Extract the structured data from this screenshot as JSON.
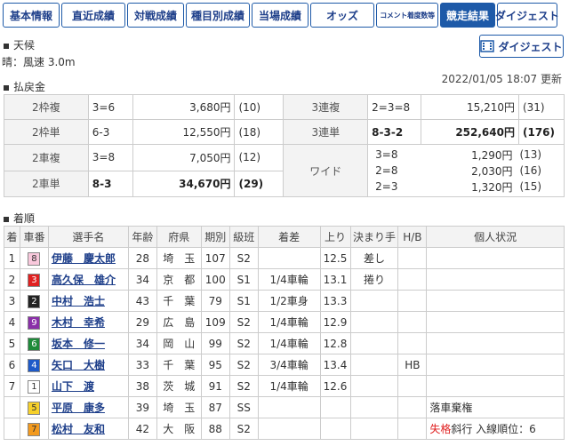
{
  "tabs": [
    {
      "label": "基本情報",
      "active": false
    },
    {
      "label": "直近成績",
      "active": false
    },
    {
      "label": "対戦成績",
      "active": false
    },
    {
      "label": "種目別成績",
      "active": false
    },
    {
      "label": "当場成績",
      "active": false
    },
    {
      "label": "オッズ",
      "active": false
    },
    {
      "label": "コメント着度数等",
      "active": false
    },
    {
      "label": "競走結果",
      "active": true
    },
    {
      "label": "ダイジェスト",
      "active": false
    }
  ],
  "weather": {
    "heading": "天候",
    "text": "晴：風速 3.0m"
  },
  "digest_button": "ダイジェスト",
  "updated": "2022/01/05 18:07 更新",
  "payout_heading": "払戻金",
  "payouts": {
    "r1": {
      "l1": "2枠複",
      "c1": "3=6",
      "a1": "3,680円",
      "p1": "(10)",
      "l2": "3連複",
      "c2": "2=3=8",
      "a2": "15,210円",
      "p2": "(31)"
    },
    "r2": {
      "l1": "2枠単",
      "c1": "6-3",
      "a1": "12,550円",
      "p1": "(18)",
      "l2": "3連単",
      "c2": "8-3-2",
      "a2": "252,640円",
      "p2": "(176)"
    },
    "r3": {
      "l1": "2車複",
      "c1": "3=8",
      "a1": "7,050円",
      "p1": "(12)",
      "l2": "ワイド"
    },
    "r4": {
      "l1": "2車単",
      "c1": "8-3",
      "a1": "34,670円",
      "p1": "(29)"
    },
    "wide": [
      {
        "combo": "3=8",
        "amount": "1,290円",
        "pop": "(13)"
      },
      {
        "combo": "2=8",
        "amount": "2,030円",
        "pop": "(16)"
      },
      {
        "combo": "2=3",
        "amount": "1,320円",
        "pop": "(15)"
      }
    ]
  },
  "results_heading": "着順",
  "results_headers": [
    "着",
    "車番",
    "選手名",
    "年齢",
    "府県",
    "期別",
    "級班",
    "着差",
    "上り",
    "決まり手",
    "H/B",
    "個人状況"
  ],
  "results": [
    {
      "rank": "1",
      "car": "8",
      "car_bg": "#f9c8dc",
      "car_fg": "#333333",
      "name": "伊藤　慶太郎",
      "age": "28",
      "pref": "埼　玉",
      "term": "107",
      "cls": "S2",
      "margin": "",
      "last": "12.5",
      "win": "差し",
      "hb": "",
      "status": "",
      "status_red": ""
    },
    {
      "rank": "2",
      "car": "3",
      "car_bg": "#e02020",
      "car_fg": "#ffffff",
      "name": "高久保　雄介",
      "age": "34",
      "pref": "京　都",
      "term": "100",
      "cls": "S1",
      "margin": "1/4車輪",
      "last": "13.1",
      "win": "捲り",
      "hb": "",
      "status": "",
      "status_red": ""
    },
    {
      "rank": "3",
      "car": "2",
      "car_bg": "#222222",
      "car_fg": "#ffffff",
      "name": "中村　浩士",
      "age": "43",
      "pref": "千　葉",
      "term": "79",
      "cls": "S1",
      "margin": "1/2車身",
      "last": "13.3",
      "win": "",
      "hb": "",
      "status": "",
      "status_red": ""
    },
    {
      "rank": "4",
      "car": "9",
      "car_bg": "#8a2fa8",
      "car_fg": "#ffffff",
      "name": "木村　幸希",
      "age": "29",
      "pref": "広　島",
      "term": "109",
      "cls": "S2",
      "margin": "1/4車輪",
      "last": "12.9",
      "win": "",
      "hb": "",
      "status": "",
      "status_red": ""
    },
    {
      "rank": "5",
      "car": "6",
      "car_bg": "#1f8a3a",
      "car_fg": "#ffffff",
      "name": "坂本　修一",
      "age": "34",
      "pref": "岡　山",
      "term": "99",
      "cls": "S2",
      "margin": "1/4車輪",
      "last": "12.8",
      "win": "",
      "hb": "",
      "status": "",
      "status_red": ""
    },
    {
      "rank": "6",
      "car": "4",
      "car_bg": "#1e5ac8",
      "car_fg": "#ffffff",
      "name": "矢口　大樹",
      "age": "33",
      "pref": "千　葉",
      "term": "95",
      "cls": "S2",
      "margin": "3/4車輪",
      "last": "13.4",
      "win": "",
      "hb": "HB",
      "status": "",
      "status_red": ""
    },
    {
      "rank": "7",
      "car": "1",
      "car_bg": "#ffffff",
      "car_fg": "#333333",
      "name": "山下　渡",
      "age": "38",
      "pref": "茨　城",
      "term": "91",
      "cls": "S2",
      "margin": "1/4車輪",
      "last": "12.6",
      "win": "",
      "hb": "",
      "status": "",
      "status_red": ""
    },
    {
      "rank": "",
      "car": "5",
      "car_bg": "#f6d02a",
      "car_fg": "#333333",
      "name": "平原　康多",
      "age": "39",
      "pref": "埼　玉",
      "term": "87",
      "cls": "SS",
      "margin": "",
      "last": "",
      "win": "",
      "hb": "",
      "status": "落車棄権",
      "status_red": ""
    },
    {
      "rank": "",
      "car": "7",
      "car_bg": "#f39a1e",
      "car_fg": "#333333",
      "name": "松村　友和",
      "age": "42",
      "pref": "大　阪",
      "term": "88",
      "cls": "S2",
      "margin": "",
      "last": "",
      "win": "",
      "hb": "",
      "status": "斜行 入線順位：6",
      "status_red": "失格"
    }
  ]
}
